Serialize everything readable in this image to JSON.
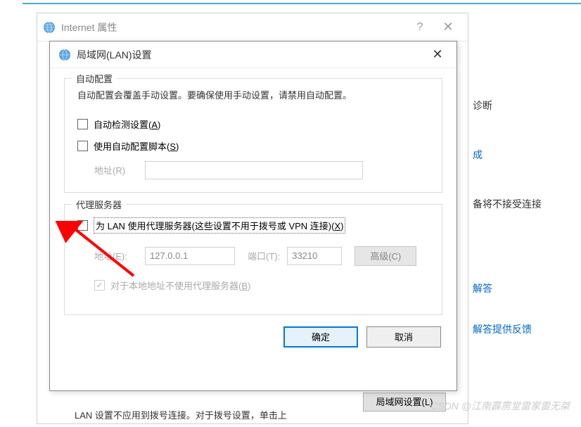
{
  "parent": {
    "title": "Internet 属性",
    "help": "?",
    "close": "✕"
  },
  "side": {
    "diag": "诊断",
    "done": "成",
    "noconn": "备将不接受连接",
    "answer": "解答",
    "feedback": "解答提供反馈"
  },
  "lan_dialog": {
    "title": "局域网(LAN)设置",
    "close": "✕",
    "auto_group": {
      "legend": "自动配置",
      "desc": "自动配置会覆盖手动设置。要确保使用手动设置，请禁用自动配置。",
      "auto_detect": "自动检测设置(",
      "auto_detect_u": "A",
      "auto_detect_end": ")",
      "use_script": "使用自动配置脚本(",
      "use_script_u": "S",
      "use_script_end": ")",
      "addr_label": "地址(R)"
    },
    "proxy_group": {
      "legend": "代理服务器",
      "use_proxy": "为 LAN 使用代理服务器(这些设置不用于拨号或 VPN 连接)(",
      "use_proxy_u": "X",
      "use_proxy_end": ")",
      "addr_label": "地址(E):",
      "addr_value": "127.0.0.1",
      "port_label": "端口(T):",
      "port_value": "33210",
      "advanced": "高级(C)",
      "bypass_local": "对于本地地址不使用代理服务器(",
      "bypass_local_u": "B",
      "bypass_local_end": ")"
    },
    "ok": "确定",
    "cancel": "取消"
  },
  "bottom_peek": {
    "heading": "局域网(LAN)设置",
    "text": "LAN 设置不应用到拨号连接。对于拨号设置，单击上",
    "btn": "局域网设置(L)"
  },
  "watermark": "CSDN @江南霹雳堂雷家雷无桀"
}
